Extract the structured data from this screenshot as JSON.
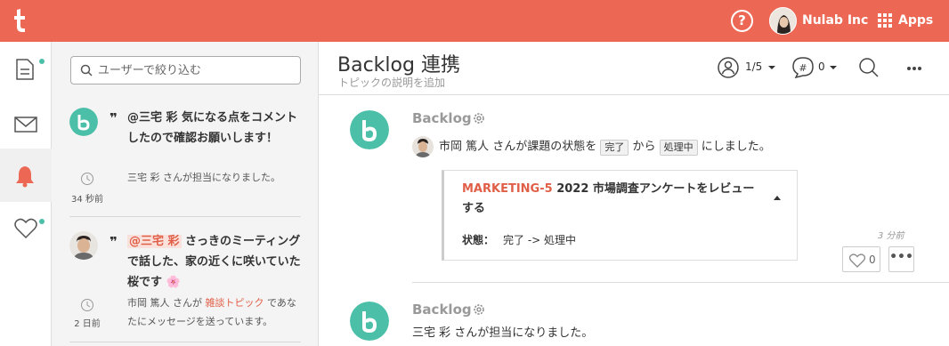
{
  "topbar": {
    "logo_icon": "typetalk-t-logo",
    "help_label": "?",
    "org_name": "Nulab Inc",
    "apps_label": "Apps"
  },
  "rail": {
    "items": [
      {
        "icon": "topic-list-icon",
        "unread": true
      },
      {
        "icon": "envelope-icon",
        "unread": false
      },
      {
        "icon": "bell-icon",
        "active": true,
        "unread": false
      },
      {
        "icon": "heart-icon",
        "unread": true
      }
    ]
  },
  "panel": {
    "search_placeholder": "ユーザーで絞り込む",
    "notifications": [
      {
        "quote": "❞",
        "title": "@三宅 彩 気になる点をコメントしたので確認お願いします！",
        "body": "三宅 彩 さんが担当になりました。",
        "time": "34 秒前"
      },
      {
        "quote": "❞",
        "mention": "@三宅 彩",
        "title_rest": " さっきのミーティングで話した、家の近くに咲いていた桜です 🌸",
        "body_prefix": "市岡 篤人 さんが ",
        "body_link": "雑談トピック",
        "body_suffix": " であなたにメッセージを送っています。",
        "time": "2 日前"
      }
    ]
  },
  "main": {
    "title": "Backlog 連携",
    "subtitle": "トピックの説明を追加",
    "members": "1/5",
    "tags_count": "0",
    "messages": [
      {
        "sender": "Backlog",
        "user": "市岡 篤人",
        "text_a": " さんが課題の状態を ",
        "from_status": "完了",
        "text_b": " から ",
        "to_status": "処理中",
        "text_c": " にしました。",
        "card": {
          "key": "MARKETING-5",
          "summary": " 2022 市場調査アンケートをレビューする",
          "status_label": "状態：",
          "status_change": "完了 -> 処理中"
        },
        "time": "3 分前",
        "likes": "0",
        "more_label": "•••"
      },
      {
        "sender": "Backlog",
        "text": "三宅 彩 さんが担当になりました。"
      }
    ]
  },
  "colors": {
    "brand": "#ed6854",
    "backlog_green": "#4bbfa8",
    "accent_text": "#e05f47"
  }
}
